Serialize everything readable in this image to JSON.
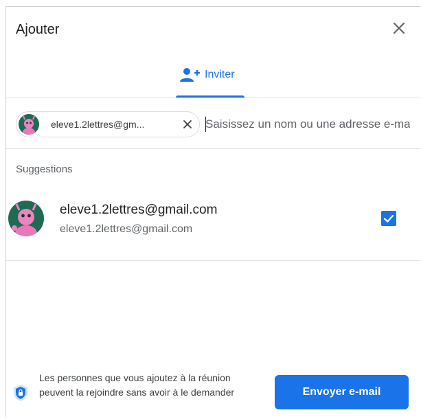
{
  "dialog": {
    "title": "Ajouter",
    "close_icon": "close-icon"
  },
  "tabs": [
    {
      "label": "Inviter",
      "icon": "person-add-icon",
      "active": true
    }
  ],
  "recipient_chip": {
    "label": "eleve1.2lettres@gm...",
    "remove_icon": "close-icon"
  },
  "search": {
    "placeholder": "Saisissez un nom ou une adresse e-mail",
    "value": ""
  },
  "suggestions": {
    "title": "Suggestions",
    "items": [
      {
        "name": "eleve1.2lettres@gmail.com",
        "email": "eleve1.2lettres@gmail.com",
        "checked": true
      }
    ]
  },
  "footer": {
    "note": "Les personnes que vous ajoutez à la réunion peuvent la rejoindre sans avoir à le demander",
    "note_icon": "shield-icon",
    "send_label": "Envoyer e-mail"
  },
  "colors": {
    "accent": "#1a73e8",
    "text_primary": "#202124",
    "text_secondary": "#5f6368",
    "divider": "#e0e0e0"
  }
}
